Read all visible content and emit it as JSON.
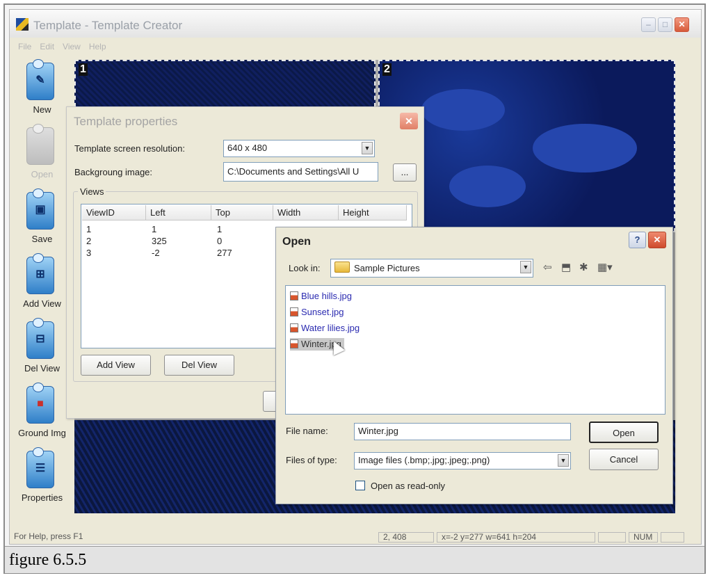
{
  "window": {
    "title": "Template - Template Creator",
    "menu": [
      "File",
      "Edit",
      "View",
      "Help"
    ],
    "controls": {
      "minimize": "–",
      "maximize": "□",
      "close": "✕"
    }
  },
  "toolbar": {
    "items": [
      {
        "label": "New",
        "icon": "new-icon",
        "enabled": true
      },
      {
        "label": "Open",
        "icon": "open-icon",
        "enabled": false
      },
      {
        "label": "Save",
        "icon": "save-icon",
        "enabled": true
      },
      {
        "label": "Add View",
        "icon": "add-view-icon",
        "enabled": true
      },
      {
        "label": "Del View",
        "icon": "del-view-icon",
        "enabled": true
      },
      {
        "label": "Ground Img",
        "icon": "ground-img-icon",
        "enabled": true
      },
      {
        "label": "Properties",
        "icon": "properties-icon",
        "enabled": true
      }
    ]
  },
  "canvas": {
    "view_labels": [
      "1",
      "2"
    ]
  },
  "template_properties": {
    "title": "Template properties",
    "resolution_label": "Template screen resolution:",
    "resolution_value": "640 x 480",
    "background_label": "Backgroung image:",
    "background_value": "C:\\Documents and Settings\\All U",
    "browse_label": "...",
    "views_group_label": "Views",
    "columns": [
      "ViewID",
      "Left",
      "Top",
      "Width",
      "Height"
    ],
    "rows": [
      {
        "id": "1",
        "left": "1",
        "top": "1"
      },
      {
        "id": "2",
        "left": "325",
        "top": "0"
      },
      {
        "id": "3",
        "left": "-2",
        "top": "277"
      }
    ],
    "add_view_label": "Add View",
    "del_view_label": "Del View"
  },
  "open_dialog": {
    "title": "Open",
    "help_label": "?",
    "close_label": "✕",
    "look_in_label": "Look in:",
    "look_in_value": "Sample Pictures",
    "files": [
      {
        "name": "Blue hills.jpg",
        "selected": false
      },
      {
        "name": "Sunset.jpg",
        "selected": false
      },
      {
        "name": "Water lilies.jpg",
        "selected": false
      },
      {
        "name": "Winter.jpg",
        "selected": true
      }
    ],
    "file_name_label": "File name:",
    "file_name_value": "Winter.jpg",
    "files_of_type_label": "Files of type:",
    "files_of_type_value": "Image files (.bmp;.jpg;.jpeg;.png)",
    "open_button": "Open",
    "cancel_button": "Cancel",
    "readonly_label": "Open as read-only",
    "readonly_checked": false
  },
  "statusbar": {
    "help_text": "For Help, press F1",
    "position": "2, 408",
    "geometry": "x=-2 y=277 w=641 h=204",
    "num": "NUM"
  },
  "caption": "figure 6.5.5"
}
